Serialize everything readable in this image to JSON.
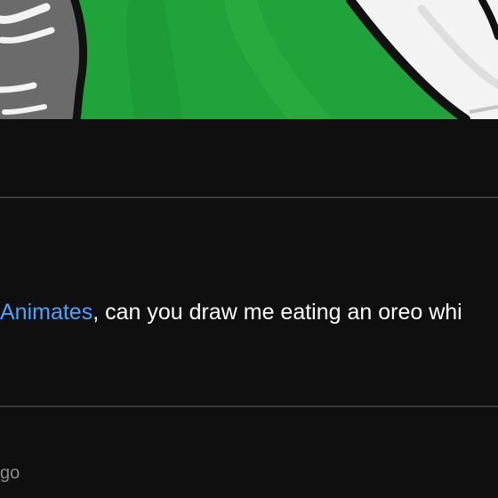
{
  "thumbnail": {
    "icon": "video-thumbnail-image",
    "colors": {
      "green": "#1fa33a",
      "gray": "#6b6b6b",
      "white": "#f3f3f3",
      "outline": "#111111"
    }
  },
  "comment": {
    "mention": "Animates",
    "text": ", can you draw me eating an oreo whi",
    "mention_color": "#4aa3ff",
    "text_color": "#ffffff"
  },
  "footer": {
    "time_fragment": "go",
    "color": "#8a8a8a"
  },
  "dividers": {
    "color": "#3a3a3a"
  }
}
